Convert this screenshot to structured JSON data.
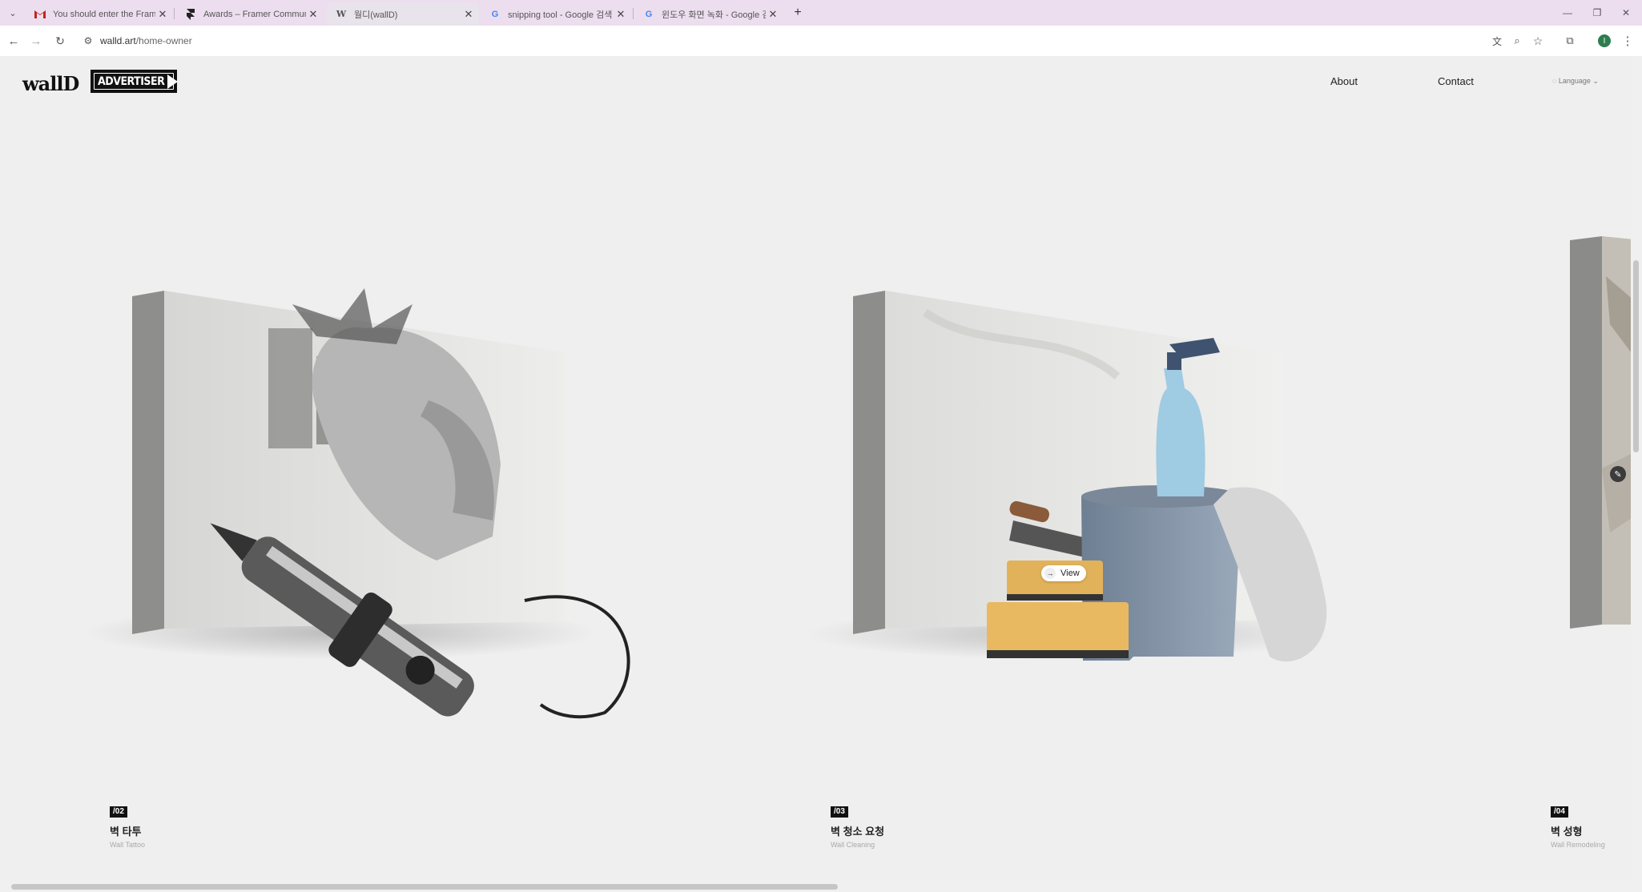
{
  "browser": {
    "tabs": [
      {
        "title": "You should enter the Framer A",
        "icon": "gmail-icon"
      },
      {
        "title": "Awards – Framer Community",
        "icon": "framer-icon"
      },
      {
        "title": "월디(wallD)",
        "icon": "walld-icon"
      },
      {
        "title": "snipping tool - Google 검색",
        "icon": "google-icon"
      },
      {
        "title": "윈도우 화면 녹화 - Google 검",
        "icon": "google-icon"
      }
    ],
    "url_host": "walld.art",
    "url_path": "/home-owner"
  },
  "site": {
    "logo": "wallD",
    "advertiser_label": "ADVERTISER",
    "nav": {
      "about": "About",
      "contact": "Contact",
      "language": "◌ Language ⌄"
    },
    "view_label": "View",
    "cards": [
      {
        "num": "/02",
        "title": "벽 타투",
        "subtitle": "Wall Tattoo"
      },
      {
        "num": "/03",
        "title": "벽 청소 요청",
        "subtitle": "Wall Cleaning"
      },
      {
        "num": "/04",
        "title": "벽 성형",
        "subtitle": "Wall Remodeling"
      }
    ]
  },
  "colors": {
    "accent": "#111111",
    "background": "#efefef",
    "tabbar": "#ecdeee"
  }
}
